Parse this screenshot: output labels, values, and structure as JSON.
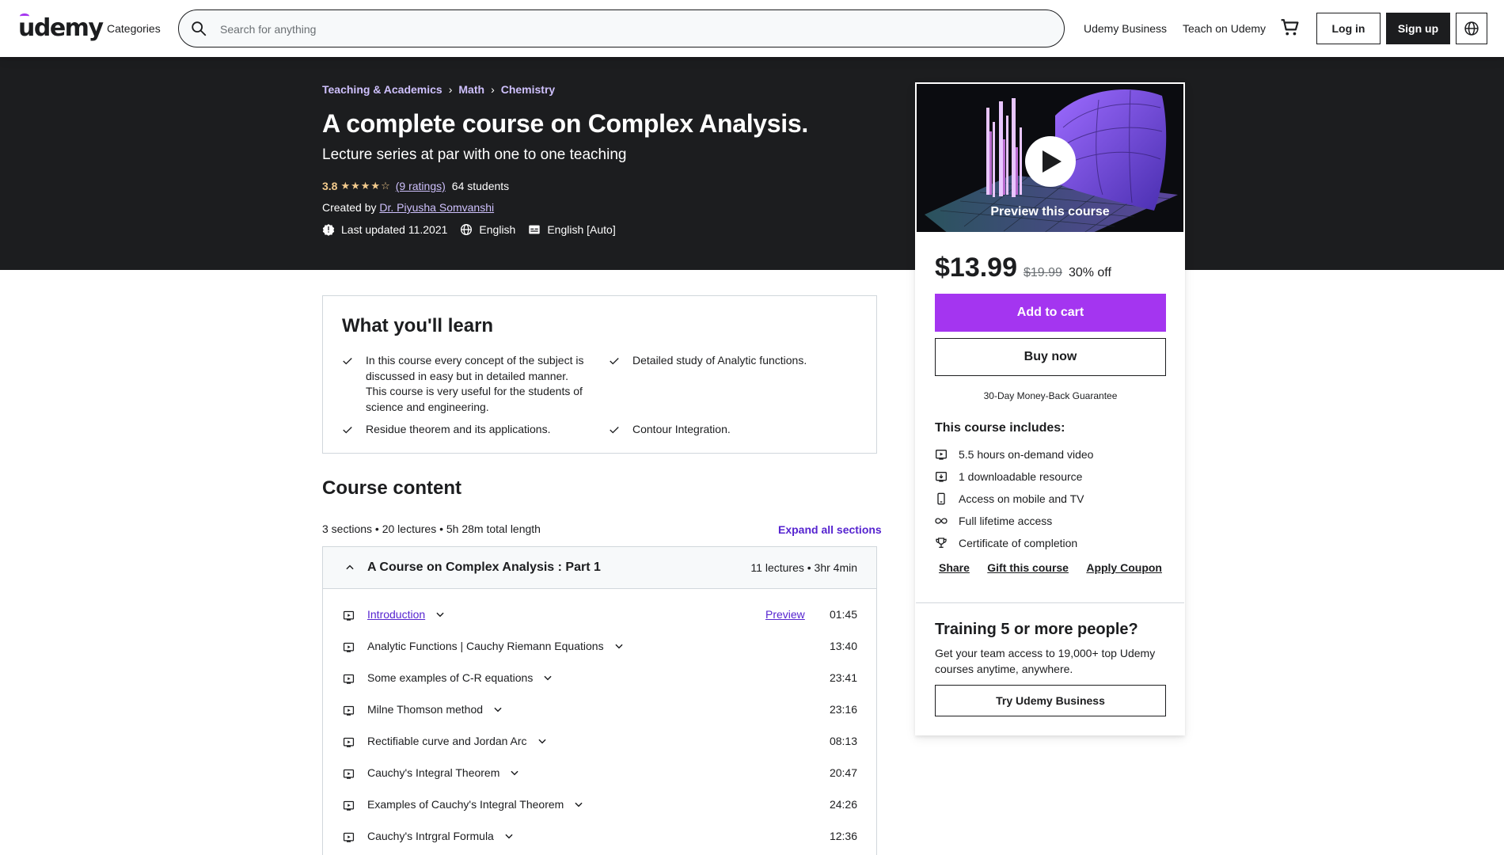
{
  "header": {
    "logo": "udemy",
    "categories": "Categories",
    "search_placeholder": "Search for anything",
    "udemy_business": "Udemy Business",
    "teach": "Teach on Udemy",
    "login": "Log in",
    "signup": "Sign up"
  },
  "course": {
    "breadcrumb": [
      "Teaching & Academics",
      "Math",
      "Chemistry"
    ],
    "title": "A complete course on Complex Analysis.",
    "subtitle": "Lecture series at par with one to one teaching",
    "rating": "3.8",
    "rating_value": 3.8,
    "ratings_count": "(9 ratings)",
    "students": "64 students",
    "created_by_label": "Created by",
    "instructor": "Dr. Piyusha Somvanshi",
    "last_updated": "Last updated 11.2021",
    "language": "English",
    "captions": "English [Auto]"
  },
  "sidebar": {
    "preview_label": "Preview this course",
    "price": "$13.99",
    "original_price": "$19.99",
    "discount": "30% off",
    "add_to_cart": "Add to cart",
    "buy_now": "Buy now",
    "guarantee": "30-Day Money-Back Guarantee",
    "includes_title": "This course includes:",
    "includes": [
      {
        "icon": "video-icon",
        "text": "5.5 hours on-demand video"
      },
      {
        "icon": "file-icon",
        "text": "1 downloadable resource"
      },
      {
        "icon": "mobile-icon",
        "text": "Access on mobile and TV"
      },
      {
        "icon": "infinity-icon",
        "text": "Full lifetime access"
      },
      {
        "icon": "trophy-icon",
        "text": "Certificate of completion"
      }
    ],
    "share": "Share",
    "gift": "Gift this course",
    "coupon": "Apply Coupon",
    "training_title": "Training 5 or more people?",
    "training_desc": "Get your team access to 19,000+ top Udemy courses anytime, anywhere.",
    "try_business": "Try Udemy Business"
  },
  "learn": {
    "title": "What you'll learn",
    "items": [
      "In this course every concept of the subject is discussed in easy but in detailed manner. This course is very useful for the students of science and engineering.",
      "Detailed study of Analytic functions.",
      "Residue theorem and its applications.",
      "Contour Integration."
    ]
  },
  "content": {
    "title": "Course content",
    "stats": "3 sections • 20 lectures • 5h 28m total length",
    "expand_all": "Expand all sections",
    "section": {
      "title": "A Course on Complex Analysis : Part 1",
      "meta": "11 lectures • 3hr 4min"
    },
    "lectures": [
      {
        "title": "Introduction",
        "preview": "Preview",
        "duration": "01:45"
      },
      {
        "title": "Analytic Functions | Cauchy Riemann Equations",
        "duration": "13:40"
      },
      {
        "title": "Some examples of C-R equations",
        "duration": "23:41"
      },
      {
        "title": "Milne Thomson method",
        "duration": "23:16"
      },
      {
        "title": "Rectifiable curve and Jordan Arc",
        "duration": "08:13"
      },
      {
        "title": "Cauchy's Integral Theorem",
        "duration": "20:47"
      },
      {
        "title": "Examples of Cauchy's Integral Theorem",
        "duration": "24:26"
      },
      {
        "title": "Cauchy's Intrgral Formula",
        "duration": "12:36"
      }
    ]
  },
  "colors": {
    "brand_purple": "#a435f0",
    "link_purple": "#5624d0",
    "hero_bg": "#1c1d1f",
    "star_gold": "#f3ca8c",
    "hero_link": "#cec0fc"
  }
}
